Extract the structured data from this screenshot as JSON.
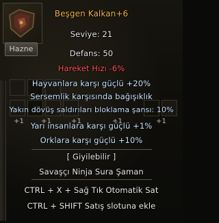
{
  "inventory": {
    "hazne_label": "Hazne",
    "slot_marks": [
      "+1",
      "+1",
      "+1",
      "+1",
      "+1"
    ]
  },
  "tooltip": {
    "item_name": "Beşgen Kalkan+6",
    "level": "Seviye: 21",
    "defense": "Defans: 50",
    "move_speed": "Hareket Hızı -6%",
    "bonuses": [
      "Hayvanlara karşı güçlü +20%",
      "Sersemlik karşısında bağışıklık",
      "Yakın dövüş saldırıları bloklama şansı: 10%",
      "Yarı insanlara karşı güçlü +1%",
      "Orklara karşı güçlü +10%"
    ],
    "wearable": "[ Giyilebilir ]",
    "classes": "Savaşçı  Ninja  Sura  Şaman",
    "hint_sell": "CTRL +   X + Sağ Tık Otomatik Sat",
    "hint_shop": "CTRL + SHIFT Satış slotuna ekle"
  },
  "colors": {
    "title": "#f4b84a",
    "text": "#ececec",
    "negative": "#ff5a5a",
    "bonus": "#cfe8ff"
  }
}
